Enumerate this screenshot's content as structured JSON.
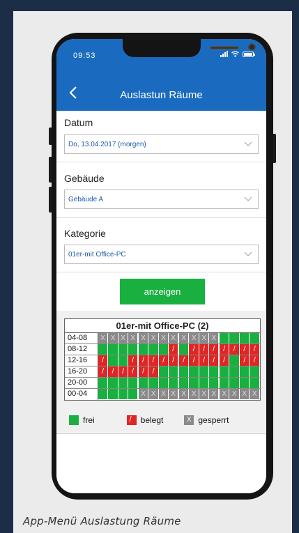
{
  "caption": "App-Menü Auslastung Räume",
  "status": {
    "time": "09:53"
  },
  "header": {
    "back_icon": "chevron-left-icon",
    "title": "Auslastun Räume"
  },
  "form": {
    "datum": {
      "label": "Datum",
      "value": "Do, 13.04.2017 (morgen)"
    },
    "gebaeude": {
      "label": "Gebäude",
      "value": "Gebäude A"
    },
    "kategorie": {
      "label": "Kategorie",
      "value": "01er-mit Office-PC"
    },
    "submit_label": "anzeigen"
  },
  "occupancy": {
    "title": "01er-mit Office-PC (2)",
    "rows": [
      {
        "time": "04-08",
        "cells": [
          "g",
          "g",
          "g",
          "g",
          "g",
          "g",
          "g",
          "g",
          "g",
          "g",
          "g",
          "g",
          "f",
          "f",
          "f",
          "f"
        ]
      },
      {
        "time": "08-12",
        "cells": [
          "f",
          "f",
          "f",
          "f",
          "f",
          "f",
          "f",
          "b",
          "f",
          "b",
          "b",
          "b",
          "b",
          "b",
          "b",
          "b"
        ]
      },
      {
        "time": "12-16",
        "cells": [
          "b",
          "f",
          "f",
          "b",
          "b",
          "b",
          "b",
          "b",
          "b",
          "b",
          "b",
          "b",
          "b",
          "f",
          "b",
          "b"
        ]
      },
      {
        "time": "16-20",
        "cells": [
          "b",
          "b",
          "b",
          "b",
          "b",
          "b",
          "f",
          "f",
          "f",
          "f",
          "f",
          "f",
          "f",
          "f",
          "f",
          "f"
        ]
      },
      {
        "time": "20-00",
        "cells": [
          "f",
          "f",
          "f",
          "f",
          "f",
          "f",
          "f",
          "f",
          "f",
          "f",
          "f",
          "f",
          "f",
          "f",
          "f",
          "f"
        ]
      },
      {
        "time": "00-04",
        "cells": [
          "f",
          "f",
          "f",
          "f",
          "g",
          "g",
          "g",
          "g",
          "g",
          "g",
          "g",
          "g",
          "g",
          "g",
          "g",
          "g"
        ]
      }
    ],
    "cell_mark_gesperrt": "X",
    "legend": {
      "frei": "frei",
      "belegt": "belegt",
      "gesperrt": "gesperrt",
      "gesperrt_mark": "X"
    },
    "colors": {
      "frei": "#19b040",
      "belegt": "#e02525",
      "gesperrt": "#8a8a8a"
    }
  }
}
